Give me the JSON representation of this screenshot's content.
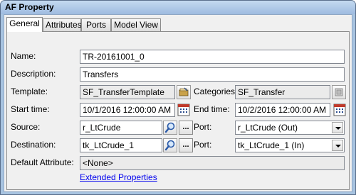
{
  "window": {
    "title": "AF Property"
  },
  "tabs": [
    {
      "label": "General",
      "active": true
    },
    {
      "label": "Attributes",
      "active": false
    },
    {
      "label": "Ports",
      "active": false
    },
    {
      "label": "Model View",
      "active": false
    }
  ],
  "form": {
    "name_label": "Name:",
    "name_value": "TR-20161001_0",
    "description_label": "Description:",
    "description_value": "Transfers",
    "template_label": "Template:",
    "template_value": "SF_TransferTemplate",
    "categories_label": "Categories:",
    "categories_value": "SF_Transfer",
    "start_label": "Start time:",
    "start_value": "10/1/2016 12:00:00 AM",
    "end_label": "End time:",
    "end_value": "10/2/2016 12:00:00 AM",
    "source_label": "Source:",
    "source_value": "r_LtCrude",
    "source_port_label": "Port:",
    "source_port_value": "r_LtCrude (Out)",
    "destination_label": "Destination:",
    "destination_value": "tk_LtCrude_1",
    "destination_port_label": "Port:",
    "destination_port_value": "tk_LtCrude_1 (In)",
    "default_attribute_label": "Default Attribute:",
    "default_attribute_value": "<None>",
    "browse_label": "...",
    "extended_properties_link": "Extended Properties"
  },
  "icons": {
    "template": "template-browse-icon",
    "categories": "categories-icon",
    "calendar": "calendar-icon",
    "search": "search-icon",
    "dropdown": "chevron-down-icon"
  }
}
